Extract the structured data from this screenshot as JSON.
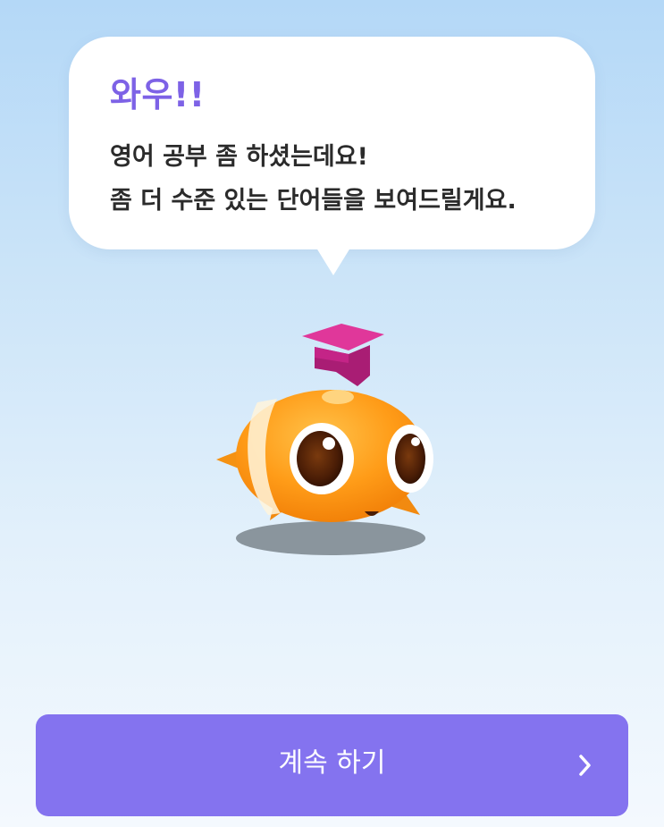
{
  "speech_bubble": {
    "title": "와우!!",
    "line1": "영어 공부 좀 하셨는데요!",
    "line2": "좀 더 수준 있는 단어들을 보여드릴게요."
  },
  "mascot": {
    "icon": "fish-mascot-with-graduation-cap-icon"
  },
  "continue_button": {
    "label": "계속 하기",
    "icon": "chevron-right-icon"
  },
  "colors": {
    "accent_purple": "#8473ef",
    "title_purple": "#7d62e6",
    "mascot_orange": "#ff9a1a",
    "cap_magenta": "#c42487"
  }
}
